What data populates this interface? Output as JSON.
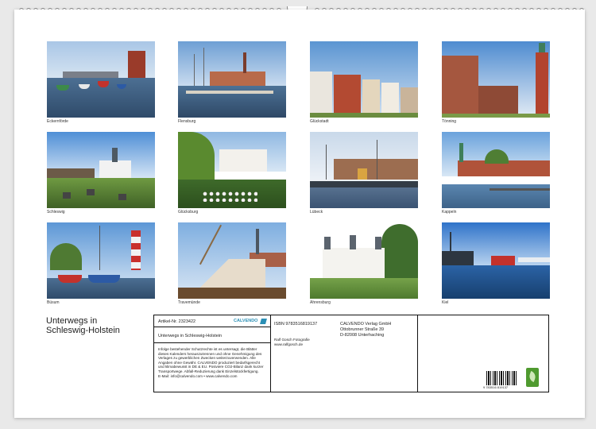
{
  "title_line1": "Unterwegs in",
  "title_line2": "Schleswig-Holstein",
  "photos": [
    {
      "caption": "Eckernförde",
      "scene": "harbor-red"
    },
    {
      "caption": "Flensburg",
      "scene": "harbor-masts"
    },
    {
      "caption": "Glückstadt",
      "scene": "houses"
    },
    {
      "caption": "Tönning",
      "scene": "church-tower"
    },
    {
      "caption": "Schleswig",
      "scene": "church-cemetery"
    },
    {
      "caption": "Glücksburg",
      "scene": "castle-flowers"
    },
    {
      "caption": "Lübeck",
      "scene": "harbor-ships"
    },
    {
      "caption": "Kappeln",
      "scene": "town-water"
    },
    {
      "caption": "Büsum",
      "scene": "lighthouse"
    },
    {
      "caption": "Travemünde",
      "scene": "sailing"
    },
    {
      "caption": "Ahrensburg",
      "scene": "white-castle"
    },
    {
      "caption": "Kiel",
      "scene": "ships-blue"
    }
  ],
  "info": {
    "artikel": "Artikel-Nr. 2323422",
    "calvendo": "CALVENDO",
    "calendar_title": "Unterwegs in Schleswig-Holstein",
    "legal_text": "Infolge bestehender Schutzrechte ist es untersagt, die Blätter dieses Kalenders herauszutrennen und ohne Genehmigung des Verlages zu gewerblichen Zwecken weiterzuverwenden. Alle Angaben ohne Gewähr. CALVENDO produziert bedarfsgerecht und klimabewusst in DE & EU. Posiviere CO2-Bilanz dank kurzer Transportwege. Abfall-Reduzierung dank Einzelstückfertigung.",
    "email": "E-Mail: info@calvendo.com • www.calvendo.com",
    "isbn": "ISBN 9783516819137",
    "photographer": "Ralf Gosch Fotografie",
    "website": "www.ralfgosch.de",
    "publisher": "CALVENDO Verlag GmbH",
    "street": "Ottobrunner Straße 39",
    "city": "D-82008 Unterhaching",
    "barcode_number": "9 783516 819137"
  },
  "colors": {
    "sky": "#7fb0dd",
    "brick": "#a8452f",
    "water": "#3d5f86",
    "green": "#5f8a3a"
  }
}
